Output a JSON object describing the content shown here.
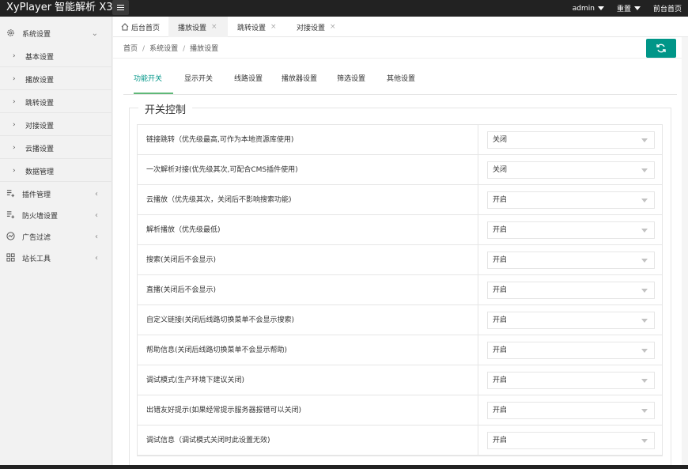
{
  "header": {
    "brand": "XyPlayer 智能解析 X3",
    "admin": "admin",
    "reset": "重置",
    "frontend": "前台首页"
  },
  "sidebar": {
    "system": "系统设置",
    "subitems": [
      "基本设置",
      "播放设置",
      "跳转设置",
      "对接设置",
      "云播设置",
      "数据管理"
    ],
    "groups": [
      "插件管理",
      "防火墙设置",
      "广告过滤",
      "站长工具"
    ]
  },
  "tabs": {
    "home": "后台首页",
    "items": [
      "播放设置",
      "跳转设置",
      "对接设置"
    ],
    "close": "×"
  },
  "breadcrumb": {
    "items": [
      "首页",
      "系统设置",
      "播放设置"
    ],
    "sep": "/"
  },
  "subtabs": [
    "功能开关",
    "显示开关",
    "线路设置",
    "播放器设置",
    "筛选设置",
    "其他设置"
  ],
  "section_title": "开关控制",
  "rows": [
    {
      "label": "链接跳转（优先级最高,可作为本地资源库使用)",
      "value": "关闭"
    },
    {
      "label": "一次解析对接(优先级其次,可配合CMS插件使用)",
      "value": "关闭"
    },
    {
      "label": "云播放（优先级其次，关闭后不影响搜索功能)",
      "value": "开启"
    },
    {
      "label": "解析播放（优先级最低)",
      "value": "开启"
    },
    {
      "label": "搜索(关闭后不会显示)",
      "value": "开启"
    },
    {
      "label": "直播(关闭后不会显示)",
      "value": "开启"
    },
    {
      "label": "自定义链接(关闭后线路切换菜单不会显示搜索)",
      "value": "开启"
    },
    {
      "label": "帮助信息(关闭后线路切换菜单不会显示帮助)",
      "value": "开启"
    },
    {
      "label": "调试模式(生产环境下建议关闭)",
      "value": "开启"
    },
    {
      "label": "出错友好提示(如果经常提示服务器报错可以关闭)",
      "value": "开启"
    },
    {
      "label": "调试信息（调试模式关闭时此设置无效)",
      "value": "开启"
    }
  ],
  "colors": {
    "accent": "#009688",
    "topbar": "#222222",
    "tab_underline": "#5fb878"
  }
}
